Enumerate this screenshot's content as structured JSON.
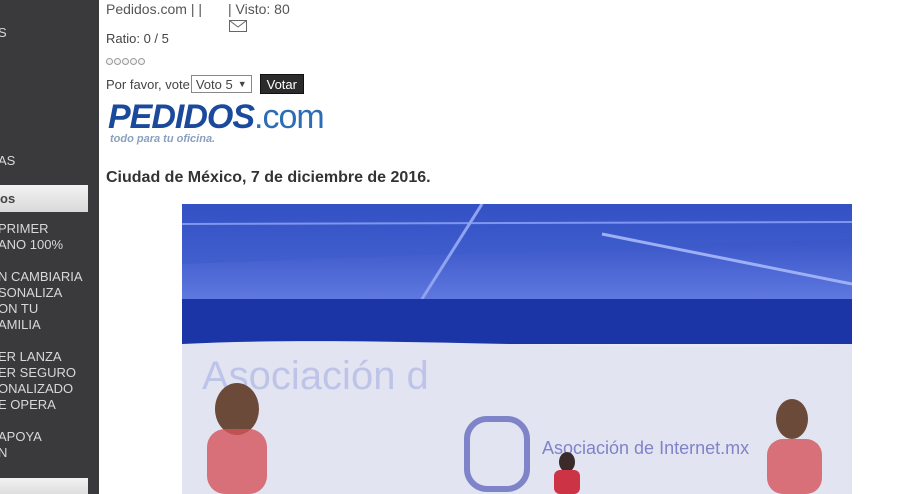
{
  "sidebar": {
    "items": [
      {
        "label": "S"
      },
      {
        "label": "AS"
      },
      {
        "label": "os"
      },
      {
        "label": "PRIMER\nANO 100%"
      },
      {
        "label": "N CAMBIARIA\nSONALIZA\nON TU\nAMILIA"
      },
      {
        "label": "ER LANZA\nER SEGURO\nONALIZADO\nE OPERA"
      },
      {
        "label": "APOYA\nN"
      }
    ]
  },
  "meta": {
    "source": "Pedidos.com",
    "separator": "| |",
    "visits": "| Visto: 80"
  },
  "rating": {
    "ratio": "Ratio: 0 / 5",
    "stars": 5
  },
  "vote": {
    "prompt": "Por favor, vote",
    "selected": "Voto 5",
    "button": "Votar"
  },
  "logo": {
    "name": "PEDIDOS",
    "suffix": ".com",
    "tagline": "todo para tu oficina."
  },
  "article": {
    "headline": "Ciudad de México, 7 de diciembre de 2016.",
    "photo_text": "Asociación de\nInternet.mx",
    "photo_bg_text": "Asociación d"
  }
}
